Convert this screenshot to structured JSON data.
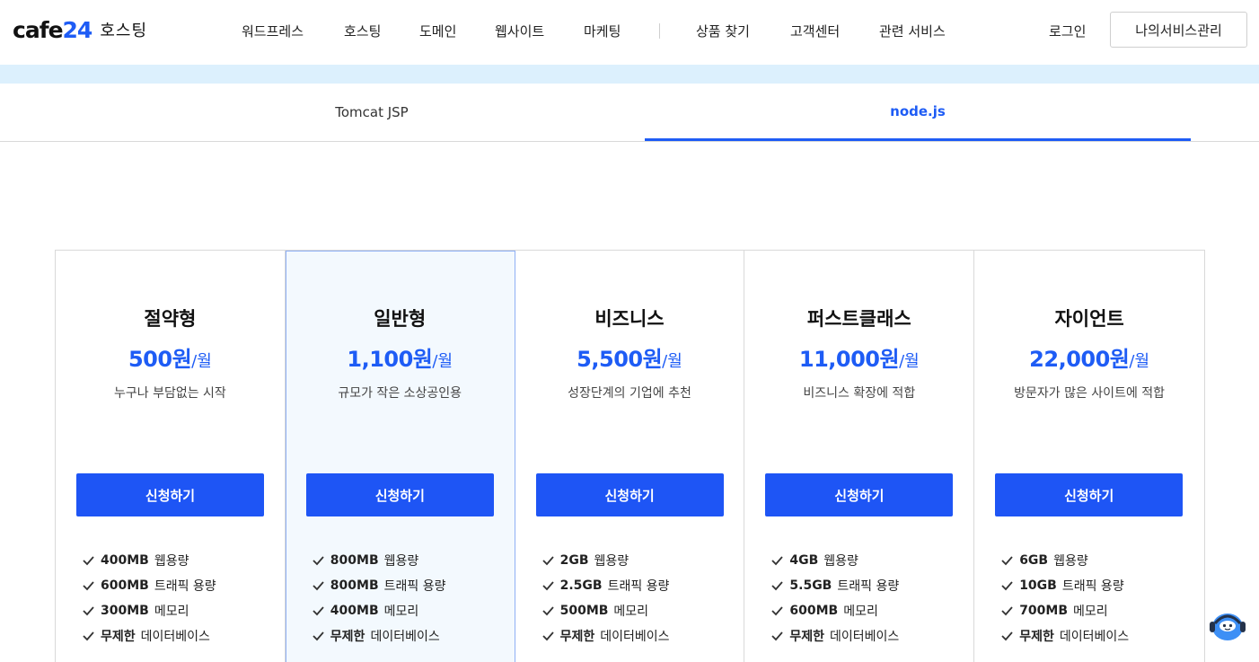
{
  "header": {
    "logo_text": "cafe",
    "logo_num": "24",
    "logo_sub": "호스팅",
    "nav": [
      "워드프레스",
      "호스팅",
      "도메인",
      "웹사이트",
      "마케팅",
      "상품 찾기",
      "고객센터",
      "관련 서비스"
    ],
    "login": "로그인",
    "my_service": "나의서비스관리"
  },
  "tabs": [
    {
      "label": "Tomcat JSP",
      "active": false
    },
    {
      "label": "node.js",
      "active": true
    }
  ],
  "plans": [
    {
      "name": "절약형",
      "price": "500원",
      "unit": "/월",
      "desc": "누구나 부담없는 시작",
      "button": "신청하기",
      "features": [
        {
          "strong": "400MB",
          "text": "웹용량"
        },
        {
          "strong": "600MB",
          "text": "트래픽 용량"
        },
        {
          "strong": "300MB",
          "text": "메모리"
        },
        {
          "strong": "무제한",
          "text": "데이터베이스"
        }
      ]
    },
    {
      "name": "일반형",
      "price": "1,100원",
      "unit": "/월",
      "desc": "규모가 작은 소상공인용",
      "button": "신청하기",
      "features": [
        {
          "strong": "800MB",
          "text": "웹용량"
        },
        {
          "strong": "800MB",
          "text": "트래픽 용량"
        },
        {
          "strong": "400MB",
          "text": "메모리"
        },
        {
          "strong": "무제한",
          "text": "데이터베이스"
        }
      ]
    },
    {
      "name": "비즈니스",
      "price": "5,500원",
      "unit": "/월",
      "desc": "성장단계의 기업에 추천",
      "button": "신청하기",
      "features": [
        {
          "strong": "2GB",
          "text": "웹용량"
        },
        {
          "strong": "2.5GB",
          "text": "트래픽 용량"
        },
        {
          "strong": "500MB",
          "text": "메모리"
        },
        {
          "strong": "무제한",
          "text": "데이터베이스"
        }
      ]
    },
    {
      "name": "퍼스트클래스",
      "price": "11,000원",
      "unit": "/월",
      "desc": "비즈니스 확장에 적합",
      "button": "신청하기",
      "features": [
        {
          "strong": "4GB",
          "text": "웹용량"
        },
        {
          "strong": "5.5GB",
          "text": "트래픽 용량"
        },
        {
          "strong": "600MB",
          "text": "메모리"
        },
        {
          "strong": "무제한",
          "text": "데이터베이스"
        }
      ]
    },
    {
      "name": "자이언트",
      "price": "22,000원",
      "unit": "/월",
      "desc": "방문자가 많은 사이트에 적합",
      "button": "신청하기",
      "features": [
        {
          "strong": "6GB",
          "text": "웹용량"
        },
        {
          "strong": "10GB",
          "text": "트래픽 용량"
        },
        {
          "strong": "700MB",
          "text": "메모리"
        },
        {
          "strong": "무제한",
          "text": "데이터베이스"
        }
      ]
    }
  ],
  "colors": {
    "accent": "#1e5cf5",
    "band": "#dcf0fd",
    "featured_bg": "#f3f9fe"
  }
}
